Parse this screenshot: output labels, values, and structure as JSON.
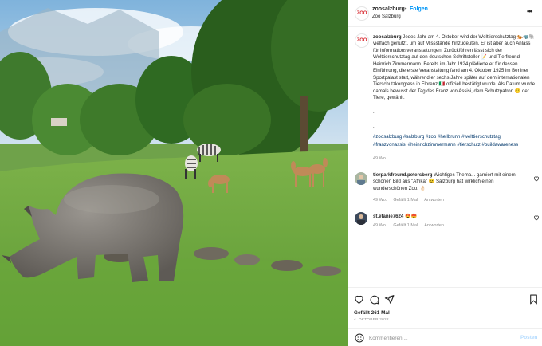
{
  "post": {
    "username": "zoosalzburg",
    "follow_label": "Folgen",
    "separator": "•",
    "location": "Zoo Salzburg",
    "logo_text": "ZOO",
    "more_label": "•••",
    "caption_text": "Jedes Jahr am 4. Oktober wird der Welttierschutztag 🐅🦏🐘 vielfach genutzt, um auf Missstände hinzudeuten. Er ist aber auch Anlass für Informationsveranstaltungen. Zurückführen lässt sich der Welttierschutztag auf den deutschen Schriftsteller 📝 und Tierfreund Heinrich Zimmermann. Bereits im Jahr 1924 plädierte er für dessen Einführung, die erste Veranstaltung fand am 4. Oktober 1925 im Berliner Sportpalast statt, während er sechs Jahre später auf dem internationalen Tierschutzkongress in Florenz 🇮🇹 offiziell bestätigt wurde. Als Datum wurde damals bewusst der Tag des Franz von Assisi, dem Schutzpatron 🙂 der Tiere, gewählt.",
    "dot": ".",
    "hashtags": "#zoosalzburg #salzburg #zoo #hellbrunn #welttierschutztag #franzvonassisi #heinrichzimmermann #tierschutz #buildawareness",
    "caption_age": "49 Wo.",
    "likes": "Gefällt 261 Mal",
    "date": "4. OKTOBER 2022"
  },
  "comments": [
    {
      "username": "tierparkfreund.petersberg",
      "text": "Wichtiges Thema... garniert mit einem schönen Bild aus \"Afrika\" 😉 Salzburg hat wirklich einen wunderschönen Zoo. 👌🏻",
      "age": "49 Wo.",
      "likes": "Gefällt 1 Mal",
      "reply": "Antworten"
    },
    {
      "username": "st.efanie7624",
      "text": "😍😍",
      "age": "49 Wo.",
      "likes": "Gefällt 1 Mal",
      "reply": "Antworten"
    }
  ],
  "comment_box": {
    "placeholder": "Kommentieren ...",
    "post_label": "Posten"
  },
  "icons": {
    "header_more": "more-horizontal-icon",
    "like": "heart-icon",
    "comment": "comment-icon",
    "share": "paper-plane-icon",
    "save": "bookmark-icon",
    "emoji": "smiley-icon",
    "comment_like": "small-heart-icon"
  },
  "colors": {
    "link_blue": "#0095f6",
    "hashtag_blue": "#00376b",
    "text": "#262626",
    "muted": "#8e8e8e",
    "post_disabled": "#b3dbff",
    "logo_red": "#d6252c"
  }
}
